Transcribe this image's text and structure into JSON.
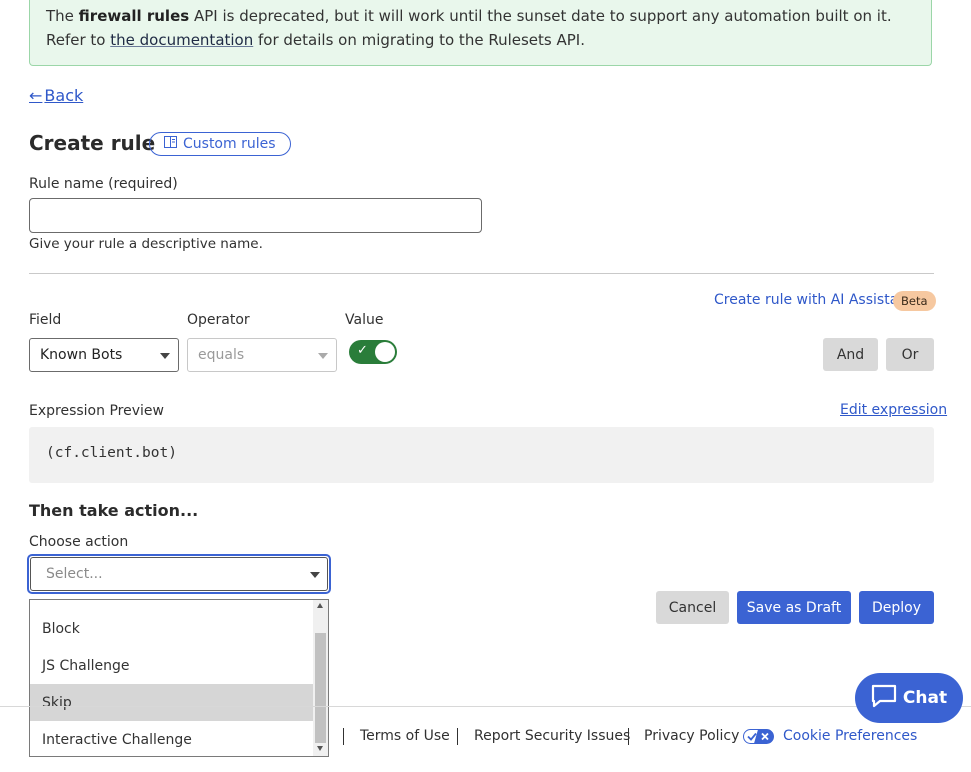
{
  "banner": {
    "prefix": "The ",
    "bold": "firewall rules",
    "middle": " API is deprecated, but it will work until the sunset date to support any automation built on it. Refer to ",
    "link": "the documentation",
    "suffix": " for details on migrating to the Rulesets API."
  },
  "back_label": "Back",
  "header": {
    "title": "Create rule",
    "pill_label": "Custom rules"
  },
  "rule_name": {
    "label": "Rule name (required)",
    "value": "",
    "hint": "Give your rule a descriptive name."
  },
  "ai": {
    "link": "Create rule with AI Assistant",
    "badge": "Beta"
  },
  "expression_builder": {
    "field_label": "Field",
    "operator_label": "Operator",
    "value_label": "Value",
    "field_value": "Known Bots",
    "operator_value": "equals",
    "value_toggle_on": true,
    "and_label": "And",
    "or_label": "Or"
  },
  "preview": {
    "label": "Expression Preview",
    "edit_link": "Edit expression",
    "expression": "(cf.client.bot)"
  },
  "action": {
    "heading": "Then take action...",
    "label": "Choose action",
    "placeholder": "Select...",
    "options": [
      "Block",
      "JS Challenge",
      "Skip",
      "Interactive Challenge"
    ],
    "highlighted": "Skip"
  },
  "buttons": {
    "cancel": "Cancel",
    "save_draft": "Save as Draft",
    "deploy": "Deploy"
  },
  "footer": {
    "links": [
      "Terms of Use",
      "Report Security Issues",
      "Privacy Policy",
      "Cookie Preferences"
    ]
  },
  "chat_label": "Chat",
  "colors": {
    "accent": "#3b63d3",
    "toggle_on": "#2a7d3a",
    "banner_bg": "#e9f7ec"
  }
}
